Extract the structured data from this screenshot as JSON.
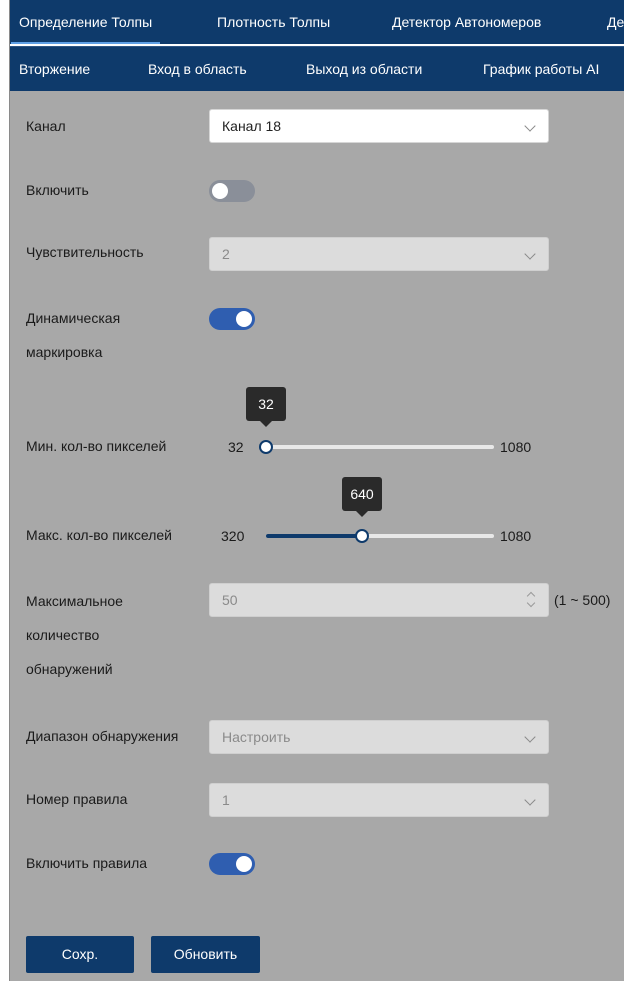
{
  "tabs_row1": [
    {
      "label": "Определение Толпы",
      "active": true
    },
    {
      "label": "Плотность Толпы",
      "active": false
    },
    {
      "label": "Детектор Автономеров",
      "active": false
    },
    {
      "label": "Де",
      "active": false
    }
  ],
  "tabs_row2": [
    {
      "label": "Вторжение"
    },
    {
      "label": "Вход в область"
    },
    {
      "label": "Выход из области"
    },
    {
      "label": "График работы AI"
    }
  ],
  "form": {
    "channel": {
      "label": "Канал",
      "value": "Канал 18"
    },
    "enable": {
      "label": "Включить",
      "on": false
    },
    "sensitivity": {
      "label": "Чувствительность",
      "value": "2"
    },
    "dynamic_marking": {
      "label_line1": "Динамическая",
      "label_line2": "маркировка",
      "on": true
    },
    "min_pixels": {
      "label": "Мин. кол-во пикселей",
      "min": "32",
      "max": "1080",
      "value": "32",
      "value_num": 32,
      "range": [
        32,
        1080
      ]
    },
    "max_pixels": {
      "label": "Макс. кол-во пикселей",
      "min": "320",
      "max": "1080",
      "value": "640",
      "value_num": 640,
      "range": [
        320,
        1080
      ]
    },
    "max_detections": {
      "label_line1": "Максимальное",
      "label_line2": "количество",
      "label_line3": "обнаружений",
      "value": "50",
      "range_hint": "(1 ~ 500)"
    },
    "detection_range": {
      "label": "Диапазон обнаружения",
      "value": "Настроить"
    },
    "rule_number": {
      "label": "Номер правила",
      "value": "1"
    },
    "enable_rules": {
      "label": "Включить правила",
      "on": true
    }
  },
  "buttons": {
    "save": "Сохр.",
    "refresh": "Обновить"
  },
  "colors": {
    "nav": "#0e3a6b",
    "panel": "#a8a8a8",
    "accent": "#2f5eb0"
  }
}
